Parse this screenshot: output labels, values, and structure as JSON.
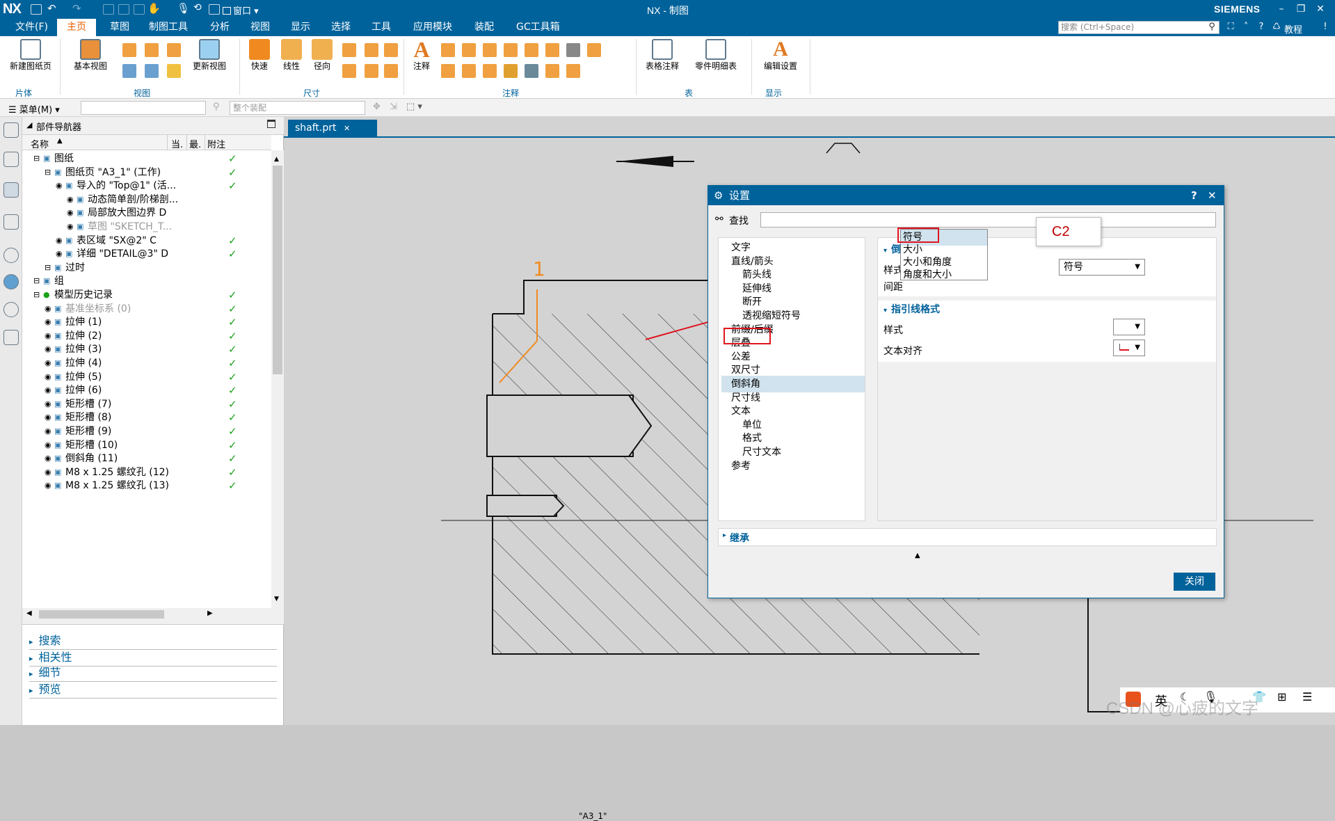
{
  "app": {
    "logo": "NX",
    "title": "NX - 制图",
    "brand": "SIEMENS",
    "window_menu": "窗口"
  },
  "window_controls": {
    "minimize": "–",
    "restore": "❐",
    "close": "✕"
  },
  "menu": {
    "tabs": [
      "文件(F)",
      "主页",
      "草图",
      "制图工具",
      "分析",
      "视图",
      "显示",
      "选择",
      "工具",
      "应用模块",
      "装配",
      "GC工具箱"
    ],
    "active": "主页",
    "search_placeholder": "搜索 (Ctrl+Space)",
    "tutorial": "教程"
  },
  "ribbon": {
    "buttons": {
      "new_sheet": "新建图纸页",
      "base_view": "基本视图",
      "update_view": "更新视图",
      "rapid": "快速",
      "linear": "线性",
      "radial": "径向",
      "note": "注释",
      "table_note": "表格注释",
      "parts_list": "零件明细表",
      "edit_settings": "编辑设置"
    },
    "groups": {
      "sheet": "片体",
      "view": "视图",
      "dimension": "尺寸",
      "annotation": "注释",
      "table": "表",
      "display": "显示"
    }
  },
  "cmdbar": {
    "menu_label": "菜单(M)",
    "assembly_placeholder": "整个装配"
  },
  "navigator": {
    "title": "部件导航器",
    "columns": {
      "name": "名称",
      "current": "当.",
      "latest": "最.",
      "attach": "附注"
    },
    "rows": [
      {
        "label": "图纸",
        "indent": 0,
        "check": "✓",
        "gray": false
      },
      {
        "label": "图纸页 \"A3_1\" (工作)",
        "indent": 1,
        "check": "✓",
        "gray": false
      },
      {
        "label": "导入的 \"Top@1\" (活...",
        "indent": 2,
        "check": "✓",
        "gray": false
      },
      {
        "label": "动态简单剖/阶梯剖...",
        "indent": 3,
        "check": "",
        "gray": false
      },
      {
        "label": "局部放大图边界 D",
        "indent": 3,
        "check": "",
        "gray": false
      },
      {
        "label": "草图 \"SKETCH_T...",
        "indent": 3,
        "check": "",
        "gray": true
      },
      {
        "label": "表区域 \"SX@2\" C",
        "indent": 2,
        "check": "✓",
        "gray": false
      },
      {
        "label": "详细 \"DETAIL@3\" D",
        "indent": 2,
        "check": "✓",
        "gray": false
      },
      {
        "label": "过时",
        "indent": 1,
        "check": "",
        "gray": false
      },
      {
        "label": "组",
        "indent": 0,
        "check": "",
        "gray": false
      },
      {
        "label": "模型历史记录",
        "indent": 0,
        "check": "✓",
        "gray": false
      },
      {
        "label": "基准坐标系 (0)",
        "indent": 1,
        "check": "✓",
        "gray": true
      },
      {
        "label": "拉伸 (1)",
        "indent": 1,
        "check": "✓",
        "gray": false
      },
      {
        "label": "拉伸 (2)",
        "indent": 1,
        "check": "✓",
        "gray": false
      },
      {
        "label": "拉伸 (3)",
        "indent": 1,
        "check": "✓",
        "gray": false
      },
      {
        "label": "拉伸 (4)",
        "indent": 1,
        "check": "✓",
        "gray": false
      },
      {
        "label": "拉伸 (5)",
        "indent": 1,
        "check": "✓",
        "gray": false
      },
      {
        "label": "拉伸 (6)",
        "indent": 1,
        "check": "✓",
        "gray": false
      },
      {
        "label": "矩形槽 (7)",
        "indent": 1,
        "check": "✓",
        "gray": false
      },
      {
        "label": "矩形槽 (8)",
        "indent": 1,
        "check": "✓",
        "gray": false
      },
      {
        "label": "矩形槽 (9)",
        "indent": 1,
        "check": "✓",
        "gray": false
      },
      {
        "label": "矩形槽 (10)",
        "indent": 1,
        "check": "✓",
        "gray": false
      },
      {
        "label": "倒斜角 (11)",
        "indent": 1,
        "check": "✓",
        "gray": false
      },
      {
        "label": "M8 x 1.25 螺纹孔 (12)",
        "indent": 1,
        "check": "✓",
        "gray": false
      },
      {
        "label": "M8 x 1.25 螺纹孔 (13)",
        "indent": 1,
        "check": "✓",
        "gray": false
      }
    ],
    "panels": [
      "搜索",
      "相关性",
      "细节",
      "预览"
    ]
  },
  "graphics": {
    "tab": "shaft.prt",
    "status": "\"A3_1\"",
    "annotation_label": "C2",
    "leader_number": "1"
  },
  "dialog": {
    "title": "设置",
    "find_label": "查找",
    "tree": [
      {
        "label": "文字",
        "indent": 0,
        "selected": false
      },
      {
        "label": "直线/箭头",
        "indent": 0,
        "selected": false
      },
      {
        "label": "箭头线",
        "indent": 1,
        "selected": false
      },
      {
        "label": "延伸线",
        "indent": 1,
        "selected": false
      },
      {
        "label": "断开",
        "indent": 1,
        "selected": false
      },
      {
        "label": "透视缩短符号",
        "indent": 1,
        "selected": false
      },
      {
        "label": "前缀/后缀",
        "indent": 0,
        "selected": false
      },
      {
        "label": "层叠",
        "indent": 0,
        "selected": false
      },
      {
        "label": "公差",
        "indent": 0,
        "selected": false
      },
      {
        "label": "双尺寸",
        "indent": 0,
        "selected": false
      },
      {
        "label": "倒斜角",
        "indent": 0,
        "selected": true
      },
      {
        "label": "尺寸线",
        "indent": 0,
        "selected": false
      },
      {
        "label": "文本",
        "indent": 0,
        "selected": false
      },
      {
        "label": "单位",
        "indent": 1,
        "selected": false
      },
      {
        "label": "格式",
        "indent": 1,
        "selected": false
      },
      {
        "label": "尺寸文本",
        "indent": 1,
        "selected": false
      },
      {
        "label": "参考",
        "indent": 0,
        "selected": false
      }
    ],
    "chamfer_format": {
      "header": "倒斜角格式",
      "style_label": "样式",
      "style_value": "符号",
      "spacing_label": "间距",
      "options": [
        "符号",
        "大小",
        "大小和角度",
        "角度和大小"
      ]
    },
    "leader_format": {
      "header": "指引线格式",
      "style_label": "样式",
      "text_align_label": "文本对齐"
    },
    "inherit": "继承",
    "close": "关闭"
  },
  "taskbar": {
    "lang": "英",
    "watermark": "CSDN @心疲的文字"
  },
  "colors": {
    "accent": "#00629b",
    "active_tab": "#e65c00",
    "check": "#1aa31a",
    "highlight": "#e0141e"
  }
}
